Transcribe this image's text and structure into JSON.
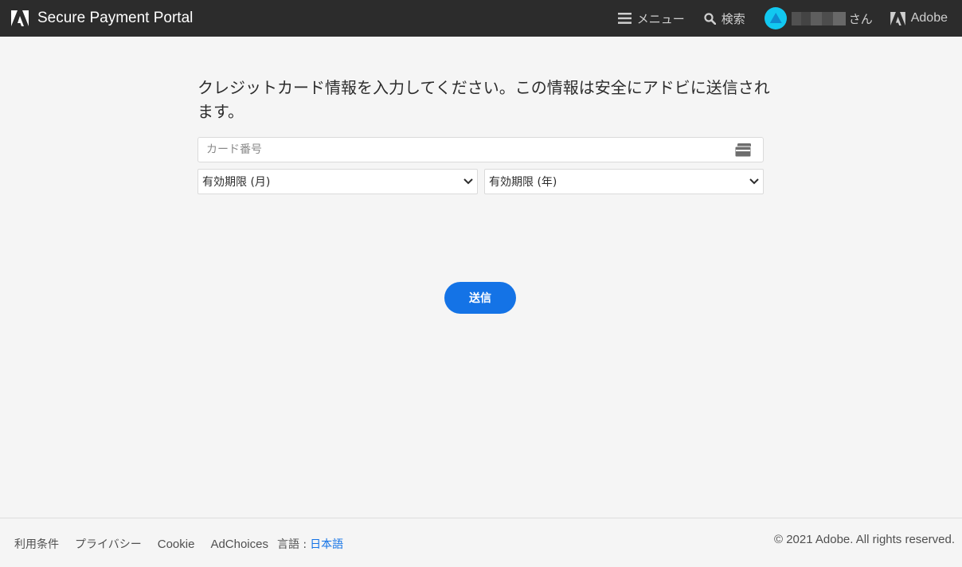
{
  "header": {
    "title": "Secure Payment Portal",
    "menu_label": "メニュー",
    "search_label": "検索",
    "user_suffix": "さん",
    "adobe_label": "Adobe"
  },
  "form": {
    "instruction": "クレジットカード情報を入力してください。この情報は安全にアドビに送信されます。",
    "card_placeholder": "カード番号",
    "expiry_month_selected": "有効期限 (月)",
    "expiry_year_selected": "有効期限 (年)",
    "submit_label": "送信"
  },
  "footer": {
    "terms": "利用条件",
    "privacy": "プライバシー",
    "cookie": "Cookie",
    "adchoices": "AdChoices",
    "language_label": "言語 :",
    "language_value": "日本語",
    "copyright": "© 2021 Adobe. All rights reserved."
  },
  "colors": {
    "topbar": "#2c2c2c",
    "accent": "#1473e6",
    "background": "#f5f5f5",
    "avatar": "#12c8f0"
  },
  "icons": [
    "adobe-logo-icon",
    "menu-icon",
    "search-icon",
    "avatar-icon",
    "credit-card-icon",
    "chevron-down-icon"
  ]
}
